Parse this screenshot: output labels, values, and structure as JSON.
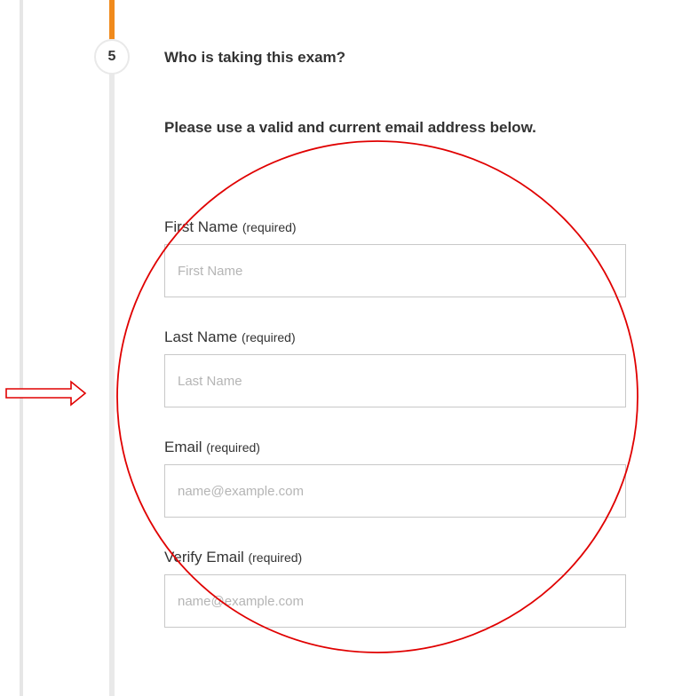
{
  "step": {
    "number": "5",
    "title": "Who is taking this exam?",
    "instruction": "Please use a valid and current email address below."
  },
  "fields": {
    "first_name": {
      "label": "First Name",
      "required": "(required)",
      "placeholder": "First Name",
      "value": ""
    },
    "last_name": {
      "label": "Last Name",
      "required": "(required)",
      "placeholder": "Last Name",
      "value": ""
    },
    "email": {
      "label": "Email",
      "required": "(required)",
      "placeholder": "name@example.com",
      "value": ""
    },
    "verify_email": {
      "label": "Verify Email",
      "required": "(required)",
      "placeholder": "name@example.com",
      "value": ""
    }
  },
  "colors": {
    "progress_accent": "#f08a1c",
    "annotation": "#e00000",
    "track": "#e9e9e9",
    "input_border": "#c8c8c8"
  },
  "annotations": {
    "arrow": "right-arrow-outline-icon",
    "circle": "red-circle-highlight"
  }
}
